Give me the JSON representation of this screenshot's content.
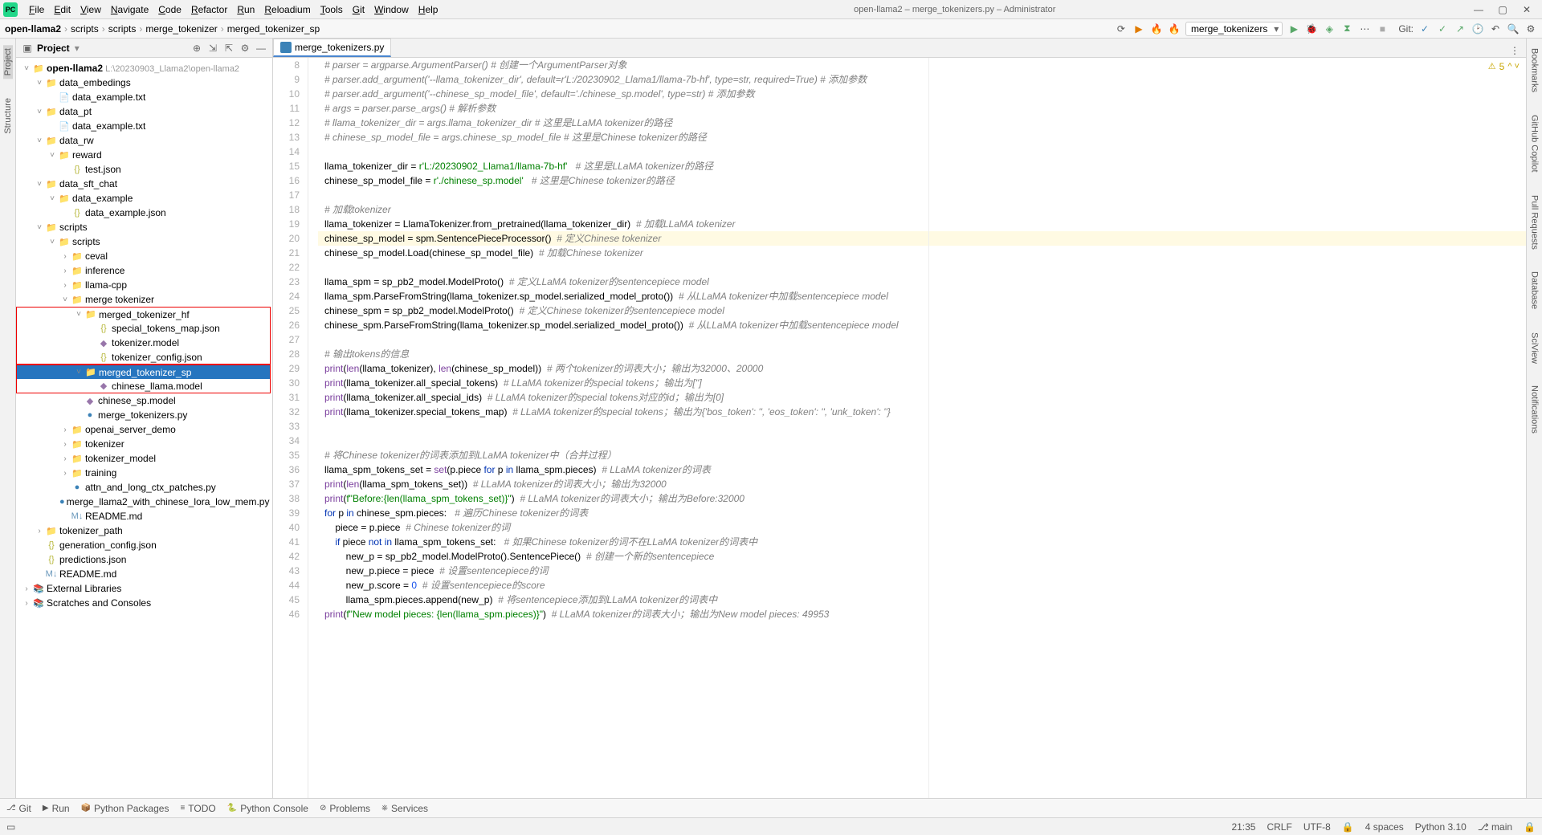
{
  "window": {
    "title": "open-llama2 – merge_tokenizers.py – Administrator",
    "min": "—",
    "max": "▢",
    "close": "✕"
  },
  "menu": [
    "File",
    "Edit",
    "View",
    "Navigate",
    "Code",
    "Refactor",
    "Run",
    "Reloadium",
    "Tools",
    "Git",
    "Window",
    "Help"
  ],
  "breadcrumb": [
    "open-llama2",
    "scripts",
    "scripts",
    "merge_tokenizer",
    "merged_tokenizer_sp"
  ],
  "nav_run_combo": "merge_tokenizers",
  "nav_git_label": "Git:",
  "project_panel": {
    "title": "Project"
  },
  "tree": [
    {
      "d": 0,
      "i": "dir",
      "t": "",
      "pre": "open-llama2",
      "suf": "  L:\\20230903_Llama2\\open-llama2",
      "exp": true,
      "root": true
    },
    {
      "d": 1,
      "i": "dir",
      "t": "",
      "pre": "data_embedings",
      "exp": true
    },
    {
      "d": 2,
      "i": "txt",
      "pre": "data_example.txt"
    },
    {
      "d": 1,
      "i": "dir",
      "t": "",
      "pre": "data_pt",
      "exp": true
    },
    {
      "d": 2,
      "i": "txt",
      "pre": "data_example.txt"
    },
    {
      "d": 1,
      "i": "dir",
      "t": "",
      "pre": "data_rw",
      "exp": true
    },
    {
      "d": 2,
      "i": "dir",
      "t": "",
      "pre": "reward",
      "exp": true
    },
    {
      "d": 3,
      "i": "json",
      "pre": "test.json"
    },
    {
      "d": 1,
      "i": "dir",
      "t": "",
      "pre": "data_sft_chat",
      "exp": true
    },
    {
      "d": 2,
      "i": "dir",
      "t": "",
      "pre": "data_example",
      "exp": true
    },
    {
      "d": 3,
      "i": "json",
      "pre": "data_example.json"
    },
    {
      "d": 1,
      "i": "dir",
      "t": "",
      "pre": "scripts",
      "exp": true
    },
    {
      "d": 2,
      "i": "dir",
      "t": "",
      "pre": "scripts",
      "exp": true
    },
    {
      "d": 3,
      "i": "dir",
      "t": "",
      "pre": "ceval"
    },
    {
      "d": 3,
      "i": "dir",
      "t": "",
      "pre": "inference"
    },
    {
      "d": 3,
      "i": "dir",
      "t": "",
      "pre": "llama-cpp"
    },
    {
      "d": 3,
      "i": "dir",
      "t": "",
      "pre": "merge tokenizer",
      "exp": true
    },
    {
      "d": 4,
      "i": "dir",
      "t": "",
      "pre": "merged_tokenizer_hf",
      "exp": true,
      "red": "top"
    },
    {
      "d": 5,
      "i": "json",
      "pre": "special_tokens_map.json",
      "red": "mid"
    },
    {
      "d": 5,
      "i": "model",
      "pre": "tokenizer.model",
      "red": "mid"
    },
    {
      "d": 5,
      "i": "json",
      "pre": "tokenizer_config.json",
      "red": "bot"
    },
    {
      "d": 4,
      "i": "dir",
      "t": "",
      "pre": "merged_tokenizer_sp",
      "exp": true,
      "sel": true,
      "red": "top"
    },
    {
      "d": 5,
      "i": "model",
      "pre": "chinese_llama.model",
      "red": "bot"
    },
    {
      "d": 4,
      "i": "model",
      "pre": "chinese_sp.model"
    },
    {
      "d": 4,
      "i": "py",
      "pre": "merge_tokenizers.py"
    },
    {
      "d": 3,
      "i": "dir",
      "t": "",
      "pre": "openai_server_demo"
    },
    {
      "d": 3,
      "i": "dir",
      "t": "",
      "pre": "tokenizer"
    },
    {
      "d": 3,
      "i": "dir",
      "t": "",
      "pre": "tokenizer_model"
    },
    {
      "d": 3,
      "i": "dir",
      "t": "",
      "pre": "training"
    },
    {
      "d": 3,
      "i": "py",
      "pre": "attn_and_long_ctx_patches.py"
    },
    {
      "d": 3,
      "i": "py",
      "pre": "merge_llama2_with_chinese_lora_low_mem.py"
    },
    {
      "d": 3,
      "i": "md",
      "pre": "README.md"
    },
    {
      "d": 1,
      "i": "dir",
      "t": "",
      "pre": "tokenizer_path"
    },
    {
      "d": 1,
      "i": "json",
      "pre": "generation_config.json"
    },
    {
      "d": 1,
      "i": "json",
      "pre": "predictions.json"
    },
    {
      "d": 1,
      "i": "md",
      "pre": "README.md"
    },
    {
      "d": 0,
      "i": "lib",
      "t": "",
      "pre": "External Libraries"
    },
    {
      "d": 0,
      "i": "lib",
      "t": "",
      "pre": "Scratches and Consoles"
    }
  ],
  "editor": {
    "tab": "merge_tokenizers.py",
    "warn_count": "5",
    "first_line": 8,
    "lines": [
      {
        "seg": [
          {
            "c": "c-comment",
            "t": "# parser = argparse.ArgumentParser() # 创建一个ArgumentParser对象"
          }
        ]
      },
      {
        "seg": [
          {
            "c": "c-comment",
            "t": "# parser.add_argument('--llama_tokenizer_dir', default=r'L:/20230902_Llama1/llama-7b-hf', type=str, required=True) # 添加参数"
          }
        ]
      },
      {
        "seg": [
          {
            "c": "c-comment",
            "t": "# parser.add_argument('--chinese_sp_model_file', default='./chinese_sp.model', type=str) # 添加参数"
          }
        ]
      },
      {
        "seg": [
          {
            "c": "c-comment",
            "t": "# args = parser.parse_args() # 解析参数"
          }
        ]
      },
      {
        "seg": [
          {
            "c": "c-comment",
            "t": "# llama_tokenizer_dir = args.llama_tokenizer_dir # 这里是LLaMA tokenizer的路径"
          }
        ]
      },
      {
        "seg": [
          {
            "c": "c-comment",
            "t": "# chinese_sp_model_file = args.chinese_sp_model_file # 这里是Chinese tokenizer的路径"
          }
        ]
      },
      {
        "seg": []
      },
      {
        "seg": [
          {
            "t": "llama_tokenizer_dir = "
          },
          {
            "c": "c-str",
            "t": "r'L:/20230902_Llama1/llama-7b-hf'"
          },
          {
            "t": "   "
          },
          {
            "c": "c-comment",
            "t": "# 这里是LLaMA tokenizer的路径"
          }
        ]
      },
      {
        "seg": [
          {
            "t": "chinese_sp_model_file = "
          },
          {
            "c": "c-str",
            "t": "r'./chinese_sp.model'"
          },
          {
            "t": "   "
          },
          {
            "c": "c-comment",
            "t": "# 这里是Chinese tokenizer的路径"
          }
        ]
      },
      {
        "seg": []
      },
      {
        "seg": [
          {
            "c": "c-comment",
            "t": "# 加载tokenizer"
          }
        ]
      },
      {
        "seg": [
          {
            "t": "llama_tokenizer = LlamaTokenizer.from_pretrained(llama_tokenizer_dir)  "
          },
          {
            "c": "c-comment",
            "t": "# 加载LLaMA tokenizer"
          }
        ]
      },
      {
        "hl": true,
        "seg": [
          {
            "t": "chinese_sp_model = spm.SentencePieceProcessor()  "
          },
          {
            "c": "c-comment",
            "t": "# 定义Chinese tokenizer"
          }
        ]
      },
      {
        "seg": [
          {
            "t": "chinese_sp_model.Load(chinese_sp_model_file)  "
          },
          {
            "c": "c-comment",
            "t": "# 加载Chinese tokenizer"
          }
        ]
      },
      {
        "seg": []
      },
      {
        "seg": [
          {
            "t": "llama_spm = sp_pb2_model.ModelProto()  "
          },
          {
            "c": "c-comment",
            "t": "# 定义LLaMA tokenizer的sentencepiece model"
          }
        ]
      },
      {
        "seg": [
          {
            "t": "llama_spm.ParseFromString(llama_tokenizer.sp_model.serialized_model_proto())  "
          },
          {
            "c": "c-comment",
            "t": "# 从LLaMA tokenizer中加载sentencepiece model"
          }
        ]
      },
      {
        "seg": [
          {
            "t": "chinese_spm = sp_pb2_model.ModelProto()  "
          },
          {
            "c": "c-comment",
            "t": "# 定义Chinese tokenizer的sentencepiece model"
          }
        ]
      },
      {
        "seg": [
          {
            "t": "chinese_spm.ParseFromString(llama_tokenizer.sp_model.serialized_model_proto())  "
          },
          {
            "c": "c-comment",
            "t": "# 从LLaMA tokenizer中加载sentencepiece model"
          }
        ]
      },
      {
        "seg": []
      },
      {
        "seg": [
          {
            "c": "c-comment",
            "t": "# 输出tokens的信息"
          }
        ]
      },
      {
        "seg": [
          {
            "c": "c-fn",
            "t": "print"
          },
          {
            "t": "("
          },
          {
            "c": "c-fn",
            "t": "len"
          },
          {
            "t": "(llama_tokenizer), "
          },
          {
            "c": "c-fn",
            "t": "len"
          },
          {
            "t": "(chinese_sp_model))  "
          },
          {
            "c": "c-comment",
            "t": "# 两个tokenizer的词表大小；输出为32000、20000"
          }
        ]
      },
      {
        "seg": [
          {
            "c": "c-fn",
            "t": "print"
          },
          {
            "t": "(llama_tokenizer.all_special_tokens)  "
          },
          {
            "c": "c-comment",
            "t": "# LLaMA tokenizer的special tokens；输出为['']"
          }
        ]
      },
      {
        "seg": [
          {
            "c": "c-fn",
            "t": "print"
          },
          {
            "t": "(llama_tokenizer.all_special_ids)  "
          },
          {
            "c": "c-comment",
            "t": "# LLaMA tokenizer的special tokens对应的id；输出为[0]"
          }
        ]
      },
      {
        "seg": [
          {
            "c": "c-fn",
            "t": "print"
          },
          {
            "t": "(llama_tokenizer.special_tokens_map)  "
          },
          {
            "c": "c-comment",
            "t": "# LLaMA tokenizer的special tokens；输出为{'bos_token': '', 'eos_token': '', 'unk_token': ''}"
          }
        ]
      },
      {
        "seg": []
      },
      {
        "seg": []
      },
      {
        "seg": [
          {
            "c": "c-comment",
            "t": "# 将Chinese tokenizer的词表添加到LLaMA tokenizer中（合并过程）"
          }
        ]
      },
      {
        "seg": [
          {
            "t": "llama_spm_tokens_set = "
          },
          {
            "c": "c-fn",
            "t": "set"
          },
          {
            "t": "(p.piece "
          },
          {
            "c": "c-kw",
            "t": "for"
          },
          {
            "t": " p "
          },
          {
            "c": "c-kw",
            "t": "in"
          },
          {
            "t": " llama_spm.pieces)  "
          },
          {
            "c": "c-comment",
            "t": "# LLaMA tokenizer的词表"
          }
        ]
      },
      {
        "seg": [
          {
            "c": "c-fn",
            "t": "print"
          },
          {
            "t": "("
          },
          {
            "c": "c-fn",
            "t": "len"
          },
          {
            "t": "(llama_spm_tokens_set))  "
          },
          {
            "c": "c-comment",
            "t": "# LLaMA tokenizer的词表大小；输出为32000"
          }
        ]
      },
      {
        "seg": [
          {
            "c": "c-fn",
            "t": "print"
          },
          {
            "t": "("
          },
          {
            "c": "c-str",
            "t": "f\"Before:{len(llama_spm_tokens_set)}\""
          },
          {
            "t": ")  "
          },
          {
            "c": "c-comment",
            "t": "# LLaMA tokenizer的词表大小；输出为Before:32000"
          }
        ]
      },
      {
        "seg": [
          {
            "c": "c-kw",
            "t": "for"
          },
          {
            "t": " p "
          },
          {
            "c": "c-kw",
            "t": "in"
          },
          {
            "t": " chinese_spm.pieces:   "
          },
          {
            "c": "c-comment",
            "t": "# 遍历Chinese tokenizer的词表"
          }
        ]
      },
      {
        "seg": [
          {
            "t": "    piece = p.piece  "
          },
          {
            "c": "c-comment",
            "t": "# Chinese tokenizer的词"
          }
        ]
      },
      {
        "seg": [
          {
            "t": "    "
          },
          {
            "c": "c-kw",
            "t": "if"
          },
          {
            "t": " piece "
          },
          {
            "c": "c-kw",
            "t": "not in"
          },
          {
            "t": " llama_spm_tokens_set:   "
          },
          {
            "c": "c-comment",
            "t": "# 如果Chinese tokenizer的词不在LLaMA tokenizer的词表中"
          }
        ]
      },
      {
        "seg": [
          {
            "t": "        new_p = sp_pb2_model.ModelProto().SentencePiece()  "
          },
          {
            "c": "c-comment",
            "t": "# 创建一个新的sentencepiece"
          }
        ]
      },
      {
        "seg": [
          {
            "t": "        new_p.piece = piece  "
          },
          {
            "c": "c-comment",
            "t": "# 设置sentencepiece的词"
          }
        ]
      },
      {
        "seg": [
          {
            "t": "        new_p.score = "
          },
          {
            "c": "c-num",
            "t": "0"
          },
          {
            "t": "  "
          },
          {
            "c": "c-comment",
            "t": "# 设置sentencepiece的score"
          }
        ]
      },
      {
        "seg": [
          {
            "t": "        llama_spm.pieces.append(new_p)  "
          },
          {
            "c": "c-comment",
            "t": "# 将sentencepiece添加到LLaMA tokenizer的词表中"
          }
        ]
      },
      {
        "seg": [
          {
            "c": "c-fn",
            "t": "print"
          },
          {
            "t": "("
          },
          {
            "c": "c-str",
            "t": "f\"New model pieces: {len(llama_spm.pieces)}\""
          },
          {
            "t": ")  "
          },
          {
            "c": "c-comment",
            "t": "# LLaMA tokenizer的词表大小；输出为New model pieces: 49953"
          }
        ]
      }
    ]
  },
  "left_tabs": [
    "Project",
    "Structure"
  ],
  "right_tabs": [
    "Bookmarks",
    "GitHub Copilot",
    "Pull Requests",
    "Database",
    "SciView",
    "Notifications"
  ],
  "toolstrip": [
    "Git",
    "Run",
    "Python Packages",
    "TODO",
    "Python Console",
    "Problems",
    "Services"
  ],
  "status": {
    "pos": "21:35",
    "eol": "CRLF",
    "enc": "UTF-8",
    "lock": "🔒",
    "indent": "4 spaces",
    "python": "Python 3.10",
    "branch": "main"
  }
}
